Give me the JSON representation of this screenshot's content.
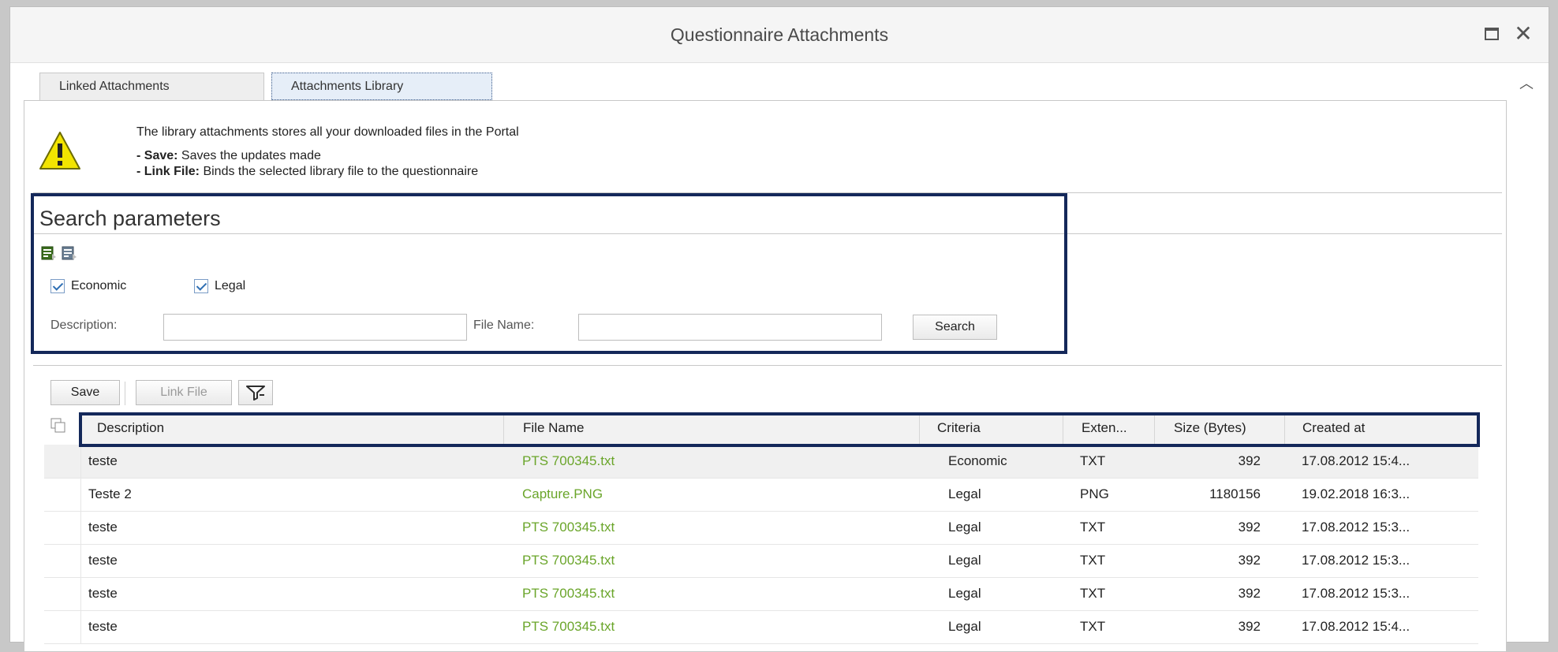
{
  "window": {
    "title": "Questionnaire Attachments"
  },
  "tabs": [
    {
      "label": "Linked Attachments"
    },
    {
      "label": "Attachments Library"
    }
  ],
  "info": {
    "intro": "The library attachments stores all your downloaded files in the Portal",
    "save_term": "- Save:",
    "save_desc": " Saves the updates made",
    "link_term": "- Link File:",
    "link_desc": " Binds the selected library file to the questionnaire"
  },
  "search": {
    "heading": "Search parameters",
    "checkboxes": [
      {
        "label": "Economic",
        "checked": true
      },
      {
        "label": "Legal",
        "checked": true
      }
    ],
    "description_label": "Description:",
    "description_value": "",
    "filename_label": "File Name:",
    "filename_value": "",
    "button": "Search"
  },
  "toolbar": {
    "save": "Save",
    "link_file": "Link File"
  },
  "table": {
    "columns": [
      "Description",
      "File Name",
      "Criteria",
      "Exten...",
      "Size (Bytes)",
      "Created at"
    ],
    "rows": [
      {
        "description": "teste",
        "file_name": "PTS 700345.txt",
        "criteria": "Economic",
        "extension": "TXT",
        "size": "392",
        "created_at": "17.08.2012 15:4..."
      },
      {
        "description": "Teste 2",
        "file_name": "Capture.PNG",
        "criteria": "Legal",
        "extension": "PNG",
        "size": "1180156",
        "created_at": "19.02.2018 16:3..."
      },
      {
        "description": "teste",
        "file_name": "PTS 700345.txt",
        "criteria": "Legal",
        "extension": "TXT",
        "size": "392",
        "created_at": "17.08.2012 15:3..."
      },
      {
        "description": "teste",
        "file_name": "PTS 700345.txt",
        "criteria": "Legal",
        "extension": "TXT",
        "size": "392",
        "created_at": "17.08.2012 15:3..."
      },
      {
        "description": "teste",
        "file_name": "PTS 700345.txt",
        "criteria": "Legal",
        "extension": "TXT",
        "size": "392",
        "created_at": "17.08.2012 15:3..."
      },
      {
        "description": "teste",
        "file_name": "PTS 700345.txt",
        "criteria": "Legal",
        "extension": "TXT",
        "size": "392",
        "created_at": "17.08.2012 15:4..."
      }
    ]
  },
  "colors": {
    "highlight": "#14285a",
    "link": "#6aa52a",
    "warning": "#f2e400"
  },
  "icons": [
    "maximize-icon",
    "close-icon",
    "scroll-up-icon",
    "warning-icon",
    "select-all-icon",
    "deselect-all-icon",
    "filter-icon",
    "select-all-rows-icon"
  ]
}
